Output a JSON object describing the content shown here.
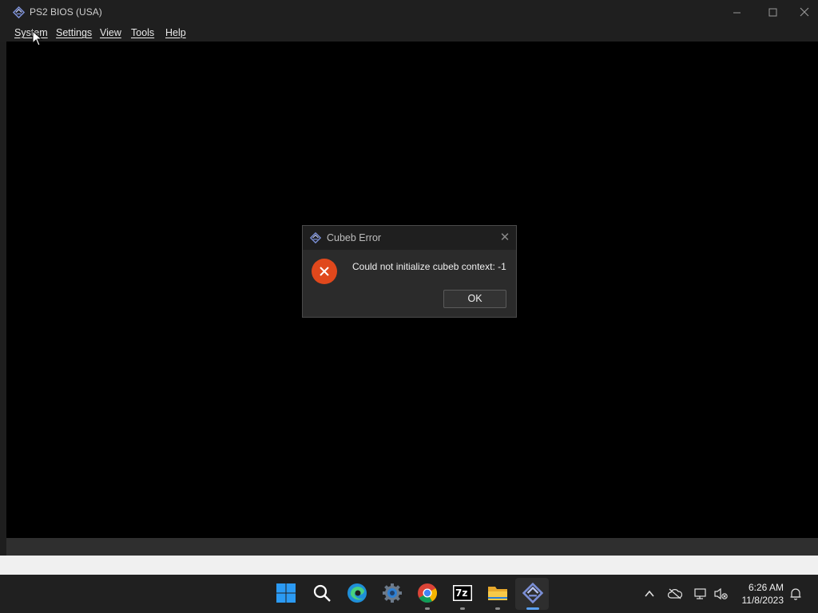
{
  "window": {
    "title": "PS2 BIOS (USA)",
    "controls": {
      "minimize": "—",
      "maximize": "☐",
      "close": "✕"
    }
  },
  "menu": {
    "items": [
      {
        "label": "System"
      },
      {
        "label": "Settings"
      },
      {
        "label": "View"
      },
      {
        "label": "Tools"
      },
      {
        "label": "Help"
      }
    ]
  },
  "dialog": {
    "title": "Cubeb Error",
    "close_glyph": "✕",
    "icon": "error-icon",
    "message": "Could not initialize cubeb context: -1",
    "ok_label": "OK"
  },
  "taskbar": {
    "apps": [
      {
        "icon": "windows-start-icon"
      },
      {
        "icon": "search-icon"
      },
      {
        "icon": "edge-icon"
      },
      {
        "icon": "settings-gear-icon"
      },
      {
        "icon": "chrome-icon"
      },
      {
        "icon": "7zip-icon",
        "label": "7z"
      },
      {
        "icon": "file-explorer-icon"
      },
      {
        "icon": "pcsx2-icon",
        "active": true
      }
    ],
    "tray": {
      "chevron": "^",
      "clock_time": "6:26 AM",
      "clock_date": "11/8/2023"
    }
  },
  "colors": {
    "error_red": "#e0481c",
    "accent_blue": "#5aa0f0",
    "titlebar": "#1f1f1f"
  }
}
